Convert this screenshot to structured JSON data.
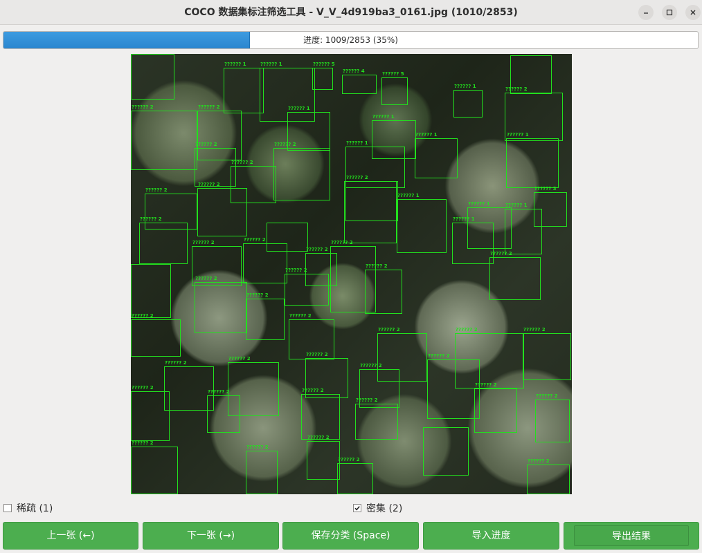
{
  "window": {
    "title": "COCO 数据集标注筛选工具 - V_V_4d919ba3_0161.jpg (1010/2853)"
  },
  "progress": {
    "label": "进度: 1009/2853 (35%)",
    "fraction": 0.354
  },
  "image": {
    "annotation_color": "#22e01e",
    "annotation_labels": [
      "?????? 1",
      "?????? 2",
      "?????? 3",
      "?????? 5",
      "?????? 4"
    ]
  },
  "checkboxes": [
    {
      "label": "稀疏 (1)",
      "checked": false
    },
    {
      "label": "密集 (2)",
      "checked": true
    }
  ],
  "buttons": {
    "prev": "上一张 (←)",
    "next": "下一张 (→)",
    "save": "保存分类 (Space)",
    "import": "导入进度",
    "export": "导出结果"
  },
  "colors": {
    "button_green": "#4cae4f",
    "progress_blue": "#2a86cf"
  }
}
